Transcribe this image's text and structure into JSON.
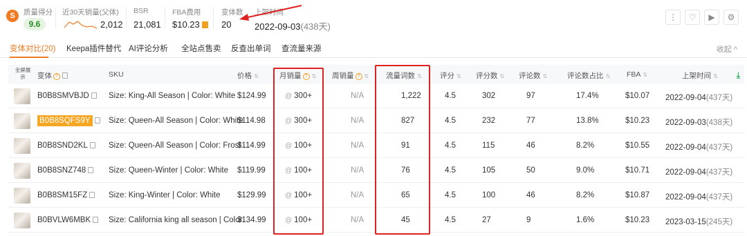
{
  "logo_glyph": "S",
  "stats": {
    "quality_label": "质量得分",
    "quality_value": "9.6",
    "sales30_label": "近30天销量(父体)",
    "sales30_value": "2,012",
    "bsr_label": "BSR",
    "bsr_value": "21,081",
    "fba_label": "FBA费用",
    "fba_value": "$10.23",
    "variants_label": "变体数",
    "variants_value": "20",
    "launch_label": "上架时间",
    "launch_date": "2022-09-03",
    "launch_days": "(438天)"
  },
  "top_icons": [
    "more-icon",
    "heart-icon",
    "play-icon",
    "settings-icon"
  ],
  "top_icon_glyphs": {
    "more": "⋮",
    "heart": "♡",
    "play": "▶",
    "settings": "⚙"
  },
  "tabs": [
    {
      "label": "变体对比(20)",
      "active": true
    },
    {
      "label": "Keepa插件替代"
    },
    {
      "label": "AI评论分析"
    },
    {
      "label": "全站点售卖"
    },
    {
      "label": "反查出单词"
    },
    {
      "label": "查流量来源"
    }
  ],
  "collapse_label": "收起 ^",
  "table": {
    "select_all": "全屏展示",
    "headers": {
      "variant": "变体",
      "sku": "SKU",
      "price": "价格",
      "monthly_sales": "月销量",
      "weekly_sales": "周销量",
      "traffic_words": "流量词数",
      "rating": "评分",
      "rating_count": "评分数",
      "review_count": "评论数",
      "review_ratio": "评论数占比",
      "fba": "FBA",
      "launch_time": "上架时间"
    },
    "rows": [
      {
        "asin": "B0B8SMVBJD",
        "sku": "Size: King-All Season | Color: White",
        "price": "$124.99",
        "monthly": "300+",
        "weekly": "N/A",
        "traffic": "1,222",
        "rating": "4.5",
        "rating_count": "302",
        "reviews": "97",
        "ratio": "17.4%",
        "fba": "$10.07",
        "date": "2022-09-04",
        "days": "(437天)"
      },
      {
        "asin": "B0B8SQFS9Y",
        "highlight": true,
        "sku": "Size: Queen-All Season | Color: White",
        "price": "$114.98",
        "monthly": "300+",
        "weekly": "N/A",
        "traffic": "827",
        "rating": "4.5",
        "rating_count": "232",
        "reviews": "77",
        "ratio": "13.8%",
        "fba": "$10.23",
        "date": "2022-09-03",
        "days": "(438天)"
      },
      {
        "asin": "B0B8SND2KL",
        "sku": "Size: Queen-All Season | Color: Frost ...",
        "price": "$114.99",
        "monthly": "100+",
        "weekly": "N/A",
        "traffic": "91",
        "rating": "4.5",
        "rating_count": "115",
        "reviews": "46",
        "ratio": "8.2%",
        "fba": "$10.55",
        "date": "2022-09-04",
        "days": "(437天)"
      },
      {
        "asin": "B0B8SNZ748",
        "sku": "Size: Queen-Winter | Color: White",
        "price": "$119.99",
        "monthly": "100+",
        "weekly": "N/A",
        "traffic": "76",
        "rating": "4.5",
        "rating_count": "105",
        "reviews": "50",
        "ratio": "9.0%",
        "fba": "$10.71",
        "date": "2022-09-04",
        "days": "(437天)"
      },
      {
        "asin": "B0B8SM15FZ",
        "sku": "Size: King-Winter | Color: White",
        "price": "$129.99",
        "monthly": "100+",
        "weekly": "N/A",
        "traffic": "65",
        "rating": "4.5",
        "rating_count": "100",
        "reviews": "46",
        "ratio": "8.2%",
        "fba": "$10.87",
        "date": "2022-09-04",
        "days": "(437天)"
      },
      {
        "asin": "B0BVLW6MBK",
        "sku": "Size: California king all season | Color...",
        "price": "$134.99",
        "monthly": "100+",
        "weekly": "N/A",
        "traffic": "45",
        "rating": "4.5",
        "rating_count": "27",
        "reviews": "9",
        "ratio": "1.6%",
        "fba": "$10.23",
        "date": "2023-03-15",
        "days": "(245天)"
      }
    ]
  },
  "glyphs": {
    "at": "@",
    "sort": "⇅",
    "qmark": "?",
    "download": "⤓",
    "arrow": "◀"
  },
  "colors": {
    "accent": "#f07b24",
    "highlight": "#f5a623",
    "annotation": "#e02020",
    "score_bg": "#e4f4e0"
  }
}
